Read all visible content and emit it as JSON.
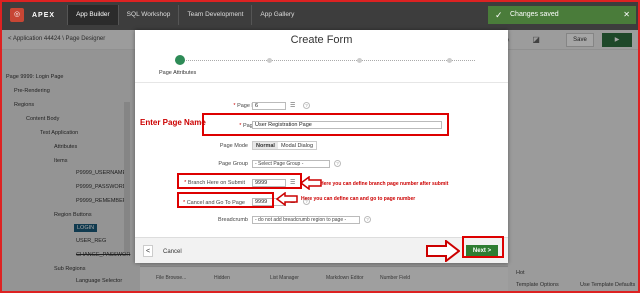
{
  "top": {
    "logo": "◎",
    "apex": "APEX",
    "nav": [
      "App Builder",
      "SQL Workshop",
      "Team Development",
      "App Gallery"
    ],
    "toast": "Changes saved",
    "toast_check": "✓",
    "toast_close": "✕"
  },
  "bar2": {
    "breadcrumb": "< Application 44424  \\  Page Designer",
    "save": "Save",
    "run": "▶",
    "icons": "⌘ ⬚ ✎ ◪"
  },
  "tree": {
    "page": "Page 9999: Login Page",
    "pre": "Pre-Rendering",
    "regions": "Regions",
    "content_body": "Content Body",
    "test_app": "Test Application",
    "attributes": "Attributes",
    "items": "Items",
    "username": "P9999_USERNAME",
    "password": "P9999_PASSWORD",
    "remember": "P9999_REMEMBER",
    "region_buttons": "Region Buttons",
    "login": "LOGIN",
    "user_reg": "USER_REG",
    "change_pass": "CHANGE_PASSWOR",
    "sub_regions": "Sub Regions",
    "lang": "Language Selector"
  },
  "right": {
    "hot": "Hot",
    "template_options": "Template Options",
    "use_defaults": "Use Template Defaults"
  },
  "bottom": [
    "File Browse...",
    "Hidden",
    "List Manager",
    "Markdown Editor",
    "Number Field"
  ],
  "modal": {
    "title": "Create Form",
    "step_label": "Page Attributes",
    "page_number_label": "Page Number",
    "page_number": "6",
    "page_name_label": "Page Name",
    "page_name": "User Registration Page",
    "page_mode_label": "Page Mode",
    "mode_normal": "Normal",
    "mode_modal": "Modal Dialog",
    "page_group_label": "Page Group",
    "page_group": "- Select Page Group -",
    "branch_label": "Branch Here on Submit",
    "branch_value": "9999",
    "cancel_goto_label": "Cancel and Go To Page",
    "cancel_goto_value": "9999",
    "breadcrumb_label": "Breadcrumb",
    "breadcrumb_value": "- do not add breadcrumb region to page -",
    "cancel": "Cancel",
    "back": "<",
    "next": "Next >",
    "help": "?",
    "list_icon": "☰"
  },
  "annotations": {
    "enter_page_name": "Enter Page Name",
    "branch_note": "Here you can define branch page number after submit",
    "cancel_note": "Here you can define can and go to page number"
  }
}
